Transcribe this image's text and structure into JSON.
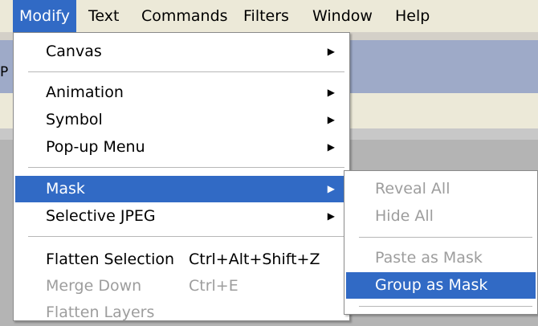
{
  "menubar": {
    "items": [
      {
        "label": "Modify"
      },
      {
        "label": "Text"
      },
      {
        "label": "Commands"
      },
      {
        "label": "Filters"
      },
      {
        "label": "Window"
      },
      {
        "label": "Help"
      }
    ]
  },
  "background": {
    "panel_fragment": "P"
  },
  "modify_menu": {
    "items": [
      {
        "label": "Canvas",
        "arrow": "▶"
      },
      {
        "label": "Animation",
        "arrow": "▶"
      },
      {
        "label": "Symbol",
        "arrow": "▶"
      },
      {
        "label": "Pop-up Menu",
        "arrow": "▶"
      },
      {
        "label": "Mask",
        "arrow": "▶"
      },
      {
        "label": "Selective JPEG",
        "arrow": "▶"
      },
      {
        "label": "Flatten Selection",
        "shortcut": "Ctrl+Alt+Shift+Z"
      },
      {
        "label": "Merge Down",
        "shortcut": "Ctrl+E"
      },
      {
        "label": "Flatten Layers"
      }
    ]
  },
  "mask_submenu": {
    "items": [
      {
        "label": "Reveal All"
      },
      {
        "label": "Hide All"
      },
      {
        "label": "Paste as Mask"
      },
      {
        "label": "Group as Mask"
      }
    ]
  },
  "colors": {
    "highlight": "#316ac5",
    "menubar_bg": "#ece9d8",
    "disabled_text": "#9d9d9d"
  }
}
